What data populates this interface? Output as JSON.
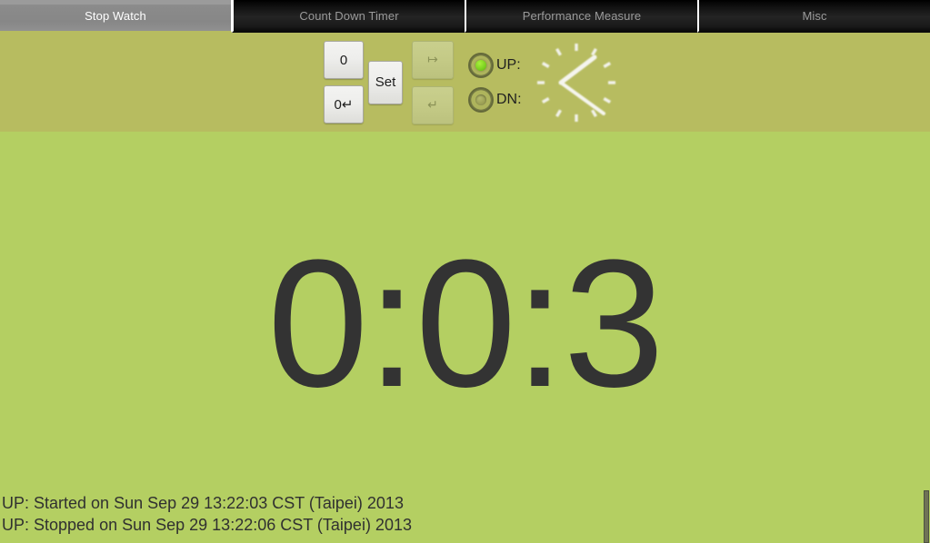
{
  "tabs": [
    {
      "label": "Stop Watch",
      "active": true
    },
    {
      "label": "Count Down Timer",
      "active": false
    },
    {
      "label": "Performance Measure",
      "active": false
    },
    {
      "label": "Misc",
      "active": false
    }
  ],
  "controls": {
    "reset_button": "0",
    "reset_lap_button": "0↵",
    "set_button": "Set",
    "forward_button": "↦",
    "return_button": "↵",
    "up_radio_label": "UP:",
    "dn_radio_label": "DN:",
    "up_selected": true,
    "dn_selected": false,
    "clock_icon_name": "analog-clock-icon"
  },
  "display": {
    "time": "0:0:3"
  },
  "log": {
    "lines": [
      "UP: Started on Sun Sep 29 13:22:03 CST (Taipei) 2013",
      "UP: Stopped on Sun Sep 29 13:22:06 CST (Taipei) 2013"
    ]
  },
  "colors": {
    "panel_olive": "#b7bc60",
    "main_green": "#b4cf62",
    "tab_active_bg": "#8a8a8a",
    "tab_inactive_bg": "#141414",
    "display_text": "#333333",
    "radio_on": "#7ed321"
  }
}
